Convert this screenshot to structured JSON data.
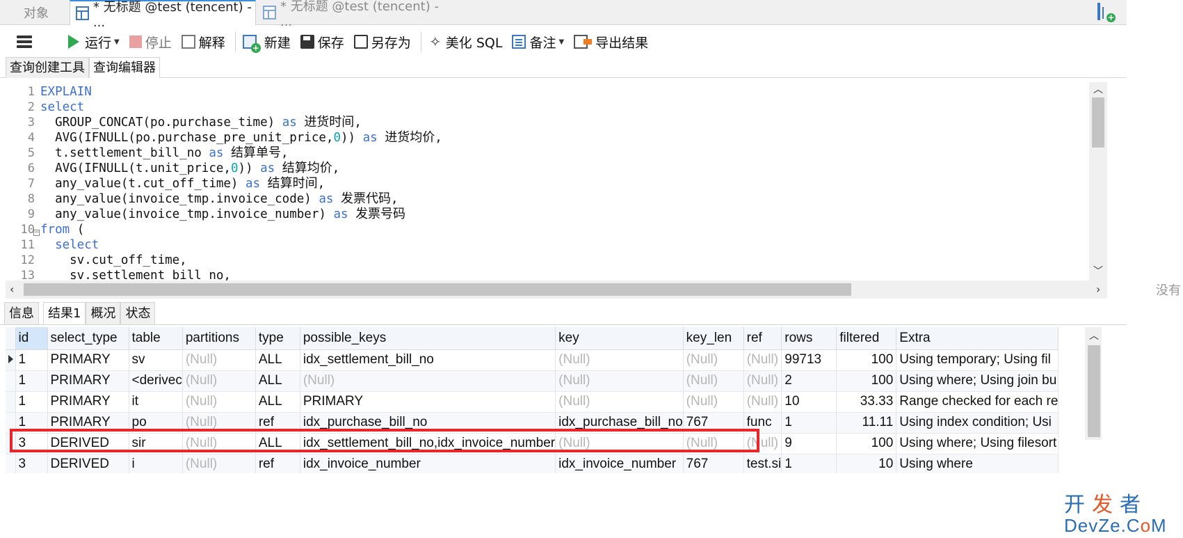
{
  "tabs": [
    {
      "label": "对象"
    },
    {
      "label": "* 无标题 @test (tencent) - ..."
    },
    {
      "label": "* 无标题 @test (tencent) - ..."
    }
  ],
  "toolbar": {
    "run": "运行",
    "stop": "停止",
    "explain": "解释",
    "new": "新建",
    "save": "保存",
    "saveas": "另存为",
    "beautify": "美化 SQL",
    "note": "备注",
    "export": "导出结果"
  },
  "subtabs": {
    "builder": "查询创建工具",
    "editor": "查询编辑器"
  },
  "editor": {
    "line_numbers": [
      "1",
      "2",
      "3",
      "4",
      "5",
      "6",
      "7",
      "8",
      "9",
      "10",
      "11",
      "12",
      "13"
    ],
    "lines": [
      [
        {
          "t": "EXPLAIN",
          "k": "kw"
        }
      ],
      [
        {
          "t": "select",
          "k": "kw"
        }
      ],
      [
        {
          "t": "  GROUP_CONCAT(po.purchase_time) ",
          "k": ""
        },
        {
          "t": "as",
          "k": "kw"
        },
        {
          "t": " ",
          "k": ""
        },
        {
          "t": "进货时间",
          "k": "cn"
        },
        {
          "t": ",",
          "k": ""
        }
      ],
      [
        {
          "t": "  AVG(IFNULL(po.purchase_pre_unit_price,",
          "k": ""
        },
        {
          "t": "0",
          "k": "num"
        },
        {
          "t": ")) ",
          "k": ""
        },
        {
          "t": "as",
          "k": "kw"
        },
        {
          "t": " ",
          "k": ""
        },
        {
          "t": "进货均价",
          "k": "cn"
        },
        {
          "t": ",",
          "k": ""
        }
      ],
      [
        {
          "t": "  t.settlement_bill_no ",
          "k": ""
        },
        {
          "t": "as",
          "k": "kw"
        },
        {
          "t": " ",
          "k": ""
        },
        {
          "t": "结算单号",
          "k": "cn"
        },
        {
          "t": ",",
          "k": ""
        }
      ],
      [
        {
          "t": "  AVG(IFNULL(t.unit_price,",
          "k": ""
        },
        {
          "t": "0",
          "k": "num"
        },
        {
          "t": ")) ",
          "k": ""
        },
        {
          "t": "as",
          "k": "kw"
        },
        {
          "t": " ",
          "k": ""
        },
        {
          "t": "结算均价",
          "k": "cn"
        },
        {
          "t": ",",
          "k": ""
        }
      ],
      [
        {
          "t": "  any_value(t.cut_off_time) ",
          "k": ""
        },
        {
          "t": "as",
          "k": "kw"
        },
        {
          "t": " ",
          "k": ""
        },
        {
          "t": "结算时间",
          "k": "cn"
        },
        {
          "t": ",",
          "k": ""
        }
      ],
      [
        {
          "t": "  any_value(invoice_tmp.invoice_code) ",
          "k": ""
        },
        {
          "t": "as",
          "k": "kw"
        },
        {
          "t": " ",
          "k": ""
        },
        {
          "t": "发票代码",
          "k": "cn"
        },
        {
          "t": ",",
          "k": ""
        }
      ],
      [
        {
          "t": "  any_value(invoice_tmp.invoice_number) ",
          "k": ""
        },
        {
          "t": "as",
          "k": "kw"
        },
        {
          "t": " ",
          "k": ""
        },
        {
          "t": "发票号码",
          "k": "cn"
        }
      ],
      [
        {
          "t": "from",
          "k": "kw"
        },
        {
          "t": " (",
          "k": ""
        }
      ],
      [
        {
          "t": "  select",
          "k": "kw"
        }
      ],
      [
        {
          "t": "    sv.cut_off_time,",
          "k": ""
        }
      ],
      [
        {
          "t": "    sv.settlement_bill_no,",
          "k": ""
        }
      ]
    ]
  },
  "result_tabs": [
    "信息",
    "结果1",
    "概况",
    "状态"
  ],
  "grid": {
    "columns": [
      "id",
      "select_type",
      "table",
      "partitions",
      "type",
      "possible_keys",
      "key",
      "key_len",
      "ref",
      "rows",
      "filtered",
      "Extra"
    ],
    "rows": [
      [
        "1",
        "PRIMARY",
        "sv",
        "(Null)",
        "ALL",
        "idx_settlement_bill_no",
        "(Null)",
        "(Null)",
        "(Null)",
        "99713",
        "100",
        "Using temporary; Using fil"
      ],
      [
        "1",
        "PRIMARY",
        "<derivec",
        "(Null)",
        "ALL",
        "(Null)",
        "(Null)",
        "(Null)",
        "(Null)",
        "2",
        "100",
        "Using where; Using join bu"
      ],
      [
        "1",
        "PRIMARY",
        "it",
        "(Null)",
        "ALL",
        "PRIMARY",
        "(Null)",
        "(Null)",
        "(Null)",
        "10",
        "33.33",
        "Range checked for each re"
      ],
      [
        "1",
        "PRIMARY",
        "po",
        "(Null)",
        "ref",
        "idx_purchase_bill_no",
        "idx_purchase_bill_no",
        "767",
        "func",
        "1",
        "11.11",
        "Using index condition; Usi"
      ],
      [
        "3",
        "DERIVED",
        "sir",
        "(Null)",
        "ALL",
        "idx_settlement_bill_no,idx_invoice_number",
        "(Null)",
        "(Null)",
        "(Null)",
        "9",
        "100",
        "Using where; Using filesort"
      ],
      [
        "3",
        "DERIVED",
        "i",
        "(Null)",
        "ref",
        "idx_invoice_number",
        "idx_invoice_number",
        "767",
        "test.si",
        "1",
        "10",
        "Using where"
      ]
    ]
  },
  "side_text": "没有",
  "watermark": {
    "top1": "开",
    "top2": "发",
    "top3": "者",
    "bottom_a": "DevZe.C",
    "bottom_o": "o",
    "bottom_b": "M"
  }
}
